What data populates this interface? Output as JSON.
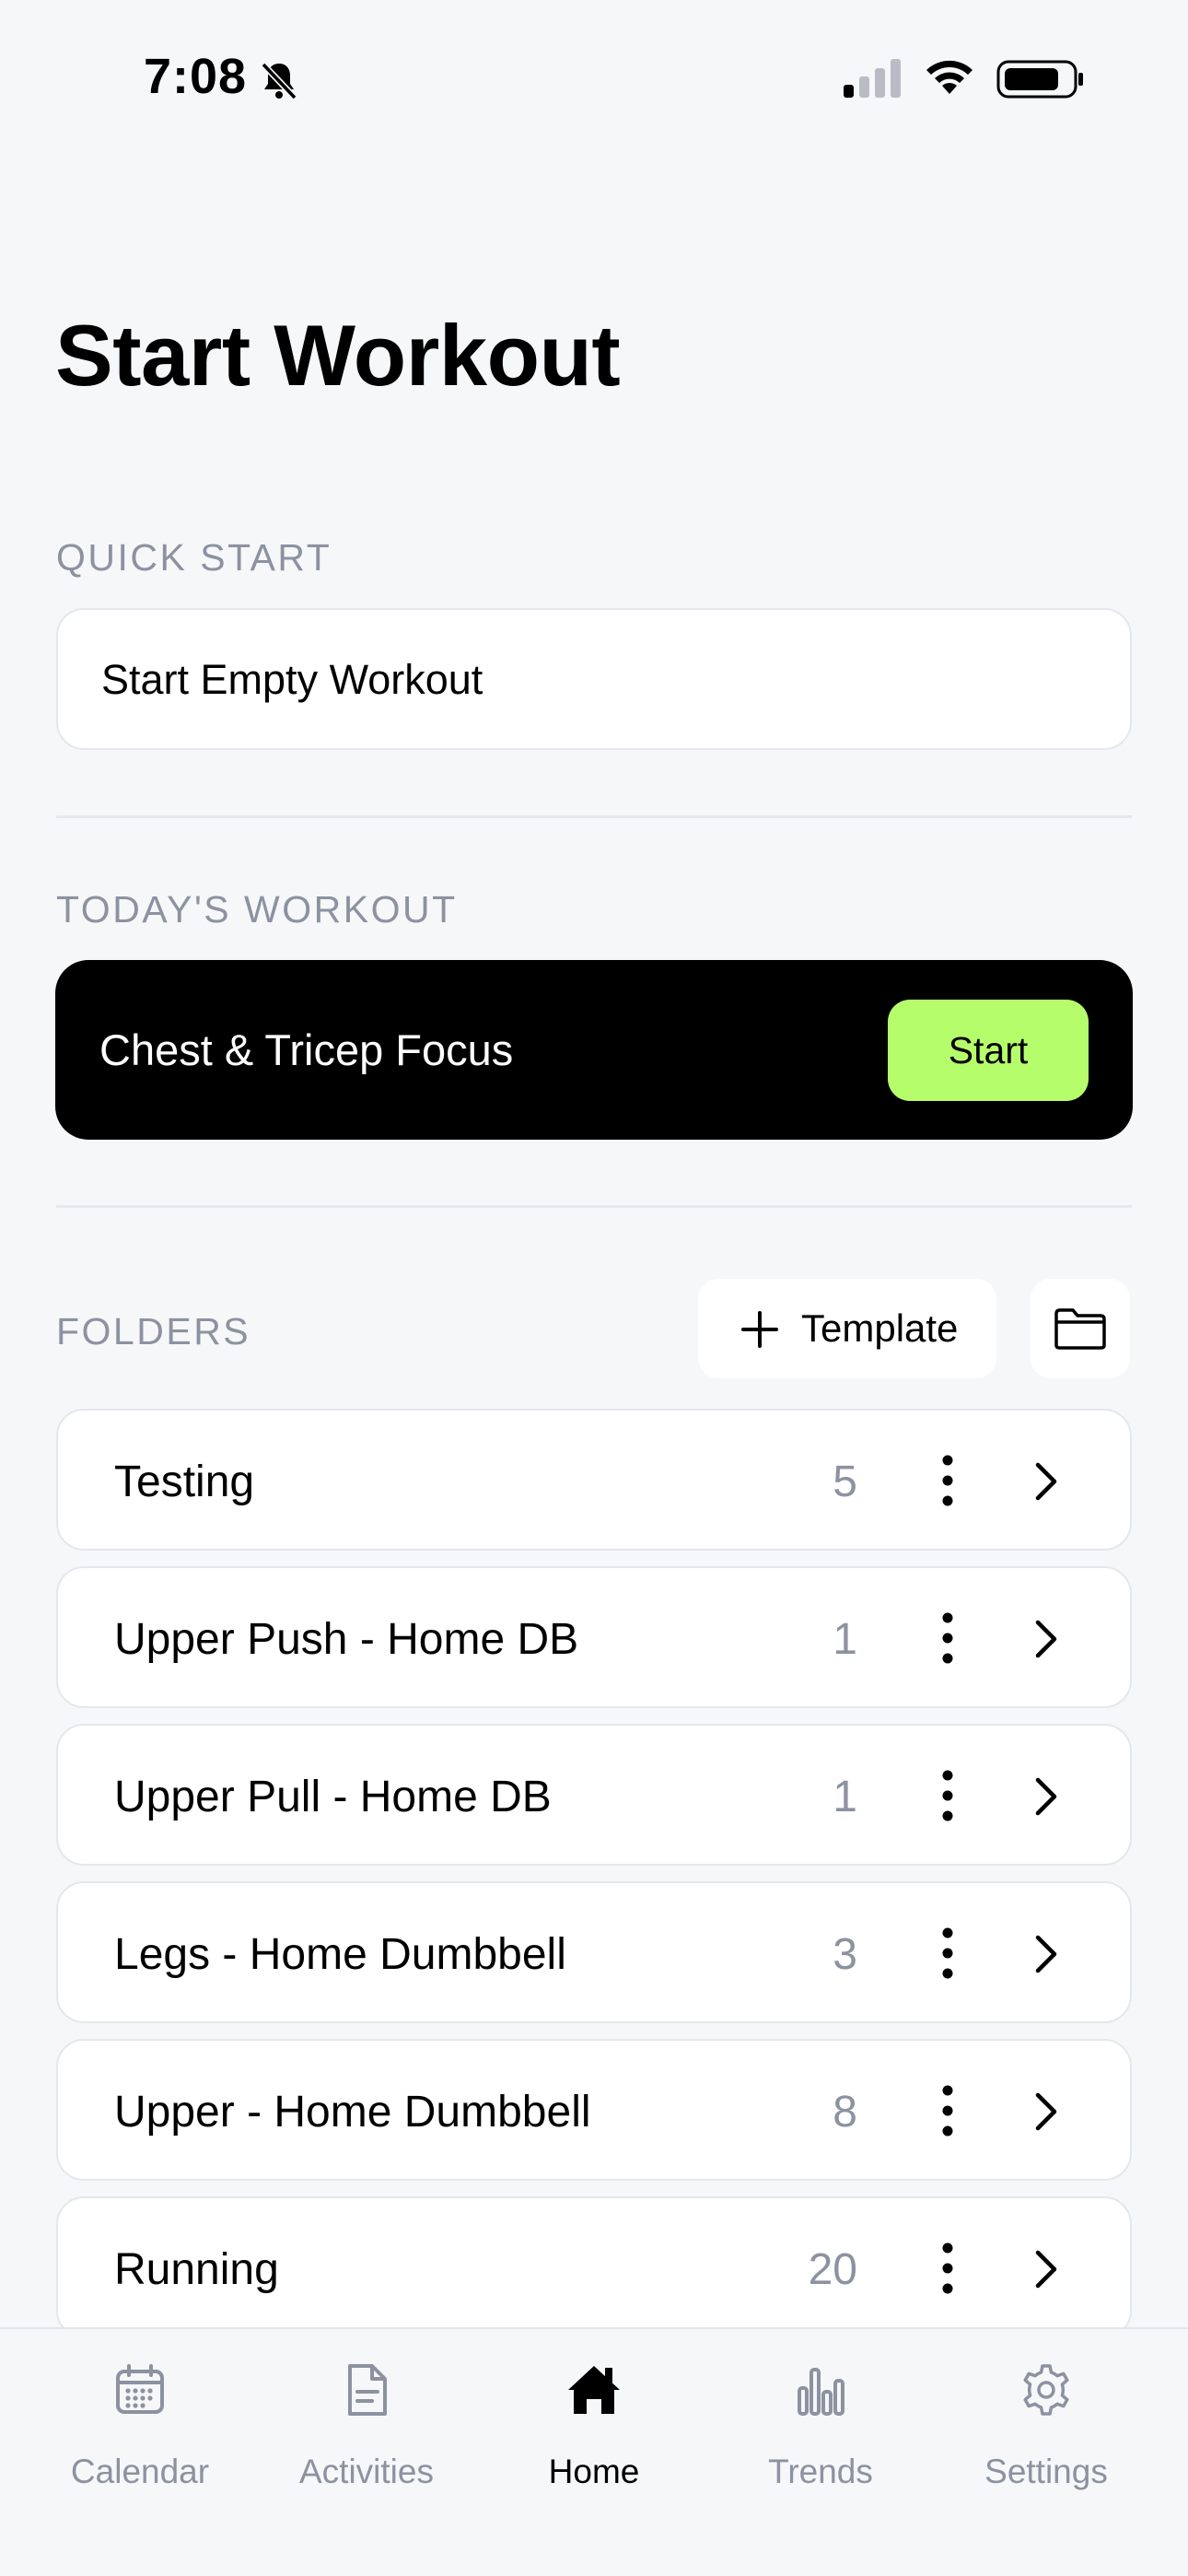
{
  "status_bar": {
    "time": "7:08",
    "icons": [
      "bell-slash-icon",
      "cellular-signal-icon",
      "wifi-icon",
      "battery-icon"
    ]
  },
  "page": {
    "title": "Start Workout"
  },
  "quick_start": {
    "label": "QUICK START",
    "empty_workout": "Start Empty Workout"
  },
  "todays_workout": {
    "label": "TODAY'S WORKOUT",
    "name": "Chest & Tricep Focus",
    "start_label": "Start"
  },
  "folders": {
    "label": "FOLDERS",
    "add_template_label": "Template",
    "items": [
      {
        "name": "Testing",
        "count": "5"
      },
      {
        "name": "Upper Push - Home DB",
        "count": "1"
      },
      {
        "name": "Upper Pull - Home DB",
        "count": "1"
      },
      {
        "name": "Legs - Home Dumbbell",
        "count": "3"
      },
      {
        "name": "Upper - Home Dumbbell",
        "count": "8"
      },
      {
        "name": "Running",
        "count": "20"
      }
    ]
  },
  "tabbar": {
    "active": "Home",
    "tabs": [
      {
        "label": "Calendar",
        "icon": "calendar-icon"
      },
      {
        "label": "Activities",
        "icon": "document-icon"
      },
      {
        "label": "Home",
        "icon": "home-icon"
      },
      {
        "label": "Trends",
        "icon": "bar-chart-icon"
      },
      {
        "label": "Settings",
        "icon": "gear-icon"
      }
    ]
  },
  "colors": {
    "background": "#f6f7f9",
    "accent": "#b6fd6b",
    "muted_text": "#8c92a0",
    "card_border": "#e4e7ec"
  }
}
